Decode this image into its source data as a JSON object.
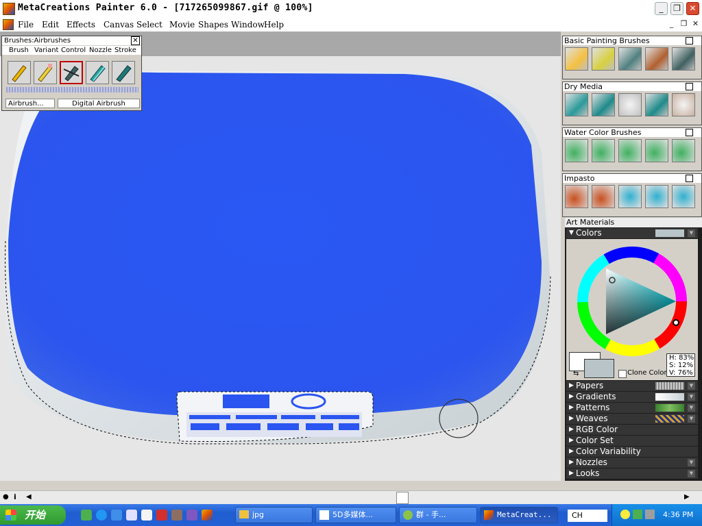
{
  "window": {
    "title": "MetaCreations Painter 6.0 - [717265099867.gif @ 100%]"
  },
  "menu": [
    "File",
    "Edit",
    "Effects",
    "Canvas",
    "Select",
    "Movie",
    "Shapes",
    "Window",
    "Help"
  ],
  "brushes_palette": {
    "title": "Brushes:Airbrushes",
    "tabs": [
      "Brush",
      "Variant",
      "Control",
      "Nozzle",
      "Stroke"
    ],
    "category": "Airbrush...",
    "variant": "Digital Airbrush"
  },
  "panels": {
    "basic_painting": "Basic Painting Brushes",
    "dry_media": "Dry Media",
    "water_color": "Water Color Brushes",
    "impasto": "Impasto"
  },
  "art_materials": {
    "title": "Art Materials",
    "colors_label": "Colors",
    "hsv": {
      "h": "H: 83%",
      "s": "S: 12%",
      "v": "V: 76%"
    },
    "clone_color": "Clone Color",
    "sections": [
      "Papers",
      "Gradients",
      "Patterns",
      "Weaves",
      "RGB Color",
      "Color Set",
      "Color Variability",
      "Nozzles",
      "Looks"
    ]
  },
  "taskbar": {
    "start": "开始",
    "buttons": [
      "jpg",
      "5D多媒体...",
      "群 - 手...",
      "MetaCreat..."
    ],
    "lang": "CH",
    "clock": "4:36 PM"
  },
  "colors": {
    "canvas_blue": "#2a55f0",
    "accent_red": "#d84a30"
  }
}
